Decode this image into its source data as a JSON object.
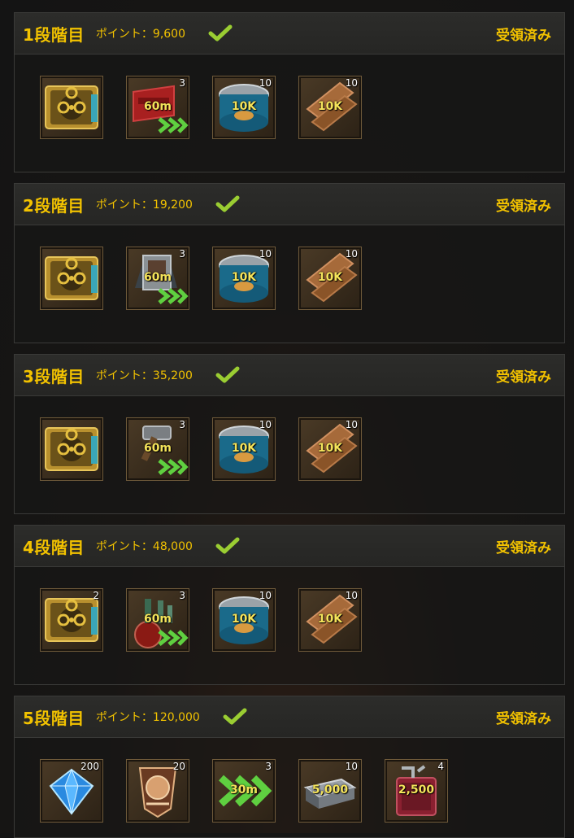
{
  "tiers": [
    {
      "name": "1段階目",
      "points": "ポイント：9,600",
      "status": "受領済み",
      "items": [
        {
          "icon": "biohazard-case-icon",
          "qty": "",
          "amount": ""
        },
        {
          "icon": "speedup-red-box-icon",
          "qty": "3",
          "amount": "60m"
        },
        {
          "icon": "food-can-icon",
          "qty": "10",
          "amount": "10K"
        },
        {
          "icon": "wood-planks-icon",
          "qty": "10",
          "amount": "10K"
        }
      ]
    },
    {
      "name": "2段階目",
      "points": "ポイント：19,200",
      "status": "受領済み",
      "items": [
        {
          "icon": "biohazard-case-icon",
          "qty": "",
          "amount": ""
        },
        {
          "icon": "speedup-book-icon",
          "qty": "3",
          "amount": "60m"
        },
        {
          "icon": "food-can-icon",
          "qty": "10",
          "amount": "10K"
        },
        {
          "icon": "wood-planks-icon",
          "qty": "10",
          "amount": "10K"
        }
      ]
    },
    {
      "name": "3段階目",
      "points": "ポイント：35,200",
      "status": "受領済み",
      "items": [
        {
          "icon": "biohazard-case-icon",
          "qty": "",
          "amount": ""
        },
        {
          "icon": "speedup-hammer-icon",
          "qty": "3",
          "amount": "60m"
        },
        {
          "icon": "food-can-icon",
          "qty": "10",
          "amount": "10K"
        },
        {
          "icon": "wood-planks-icon",
          "qty": "10",
          "amount": "10K"
        }
      ]
    },
    {
      "name": "4段階目",
      "points": "ポイント：48,000",
      "status": "受領済み",
      "items": [
        {
          "icon": "biohazard-case-icon",
          "qty": "2",
          "amount": ""
        },
        {
          "icon": "speedup-flask-icon",
          "qty": "3",
          "amount": "60m"
        },
        {
          "icon": "food-can-icon",
          "qty": "10",
          "amount": "10K"
        },
        {
          "icon": "wood-planks-icon",
          "qty": "10",
          "amount": "10K"
        }
      ]
    },
    {
      "name": "5段階目",
      "points": "ポイント：120,000",
      "status": "受領済み",
      "items": [
        {
          "icon": "diamond-icon",
          "qty": "200",
          "amount": ""
        },
        {
          "icon": "medal-badge-icon",
          "qty": "20",
          "amount": ""
        },
        {
          "icon": "speedup-chevron-icon",
          "qty": "3",
          "amount": "30m"
        },
        {
          "icon": "steel-ingot-icon",
          "qty": "10",
          "amount": "5,000"
        },
        {
          "icon": "fuel-canister-icon",
          "qty": "4",
          "amount": "2,500"
        }
      ]
    }
  ],
  "colors": {
    "accent": "#f2c200",
    "check": "#9acd32",
    "amount_text": "#f4e35a"
  }
}
